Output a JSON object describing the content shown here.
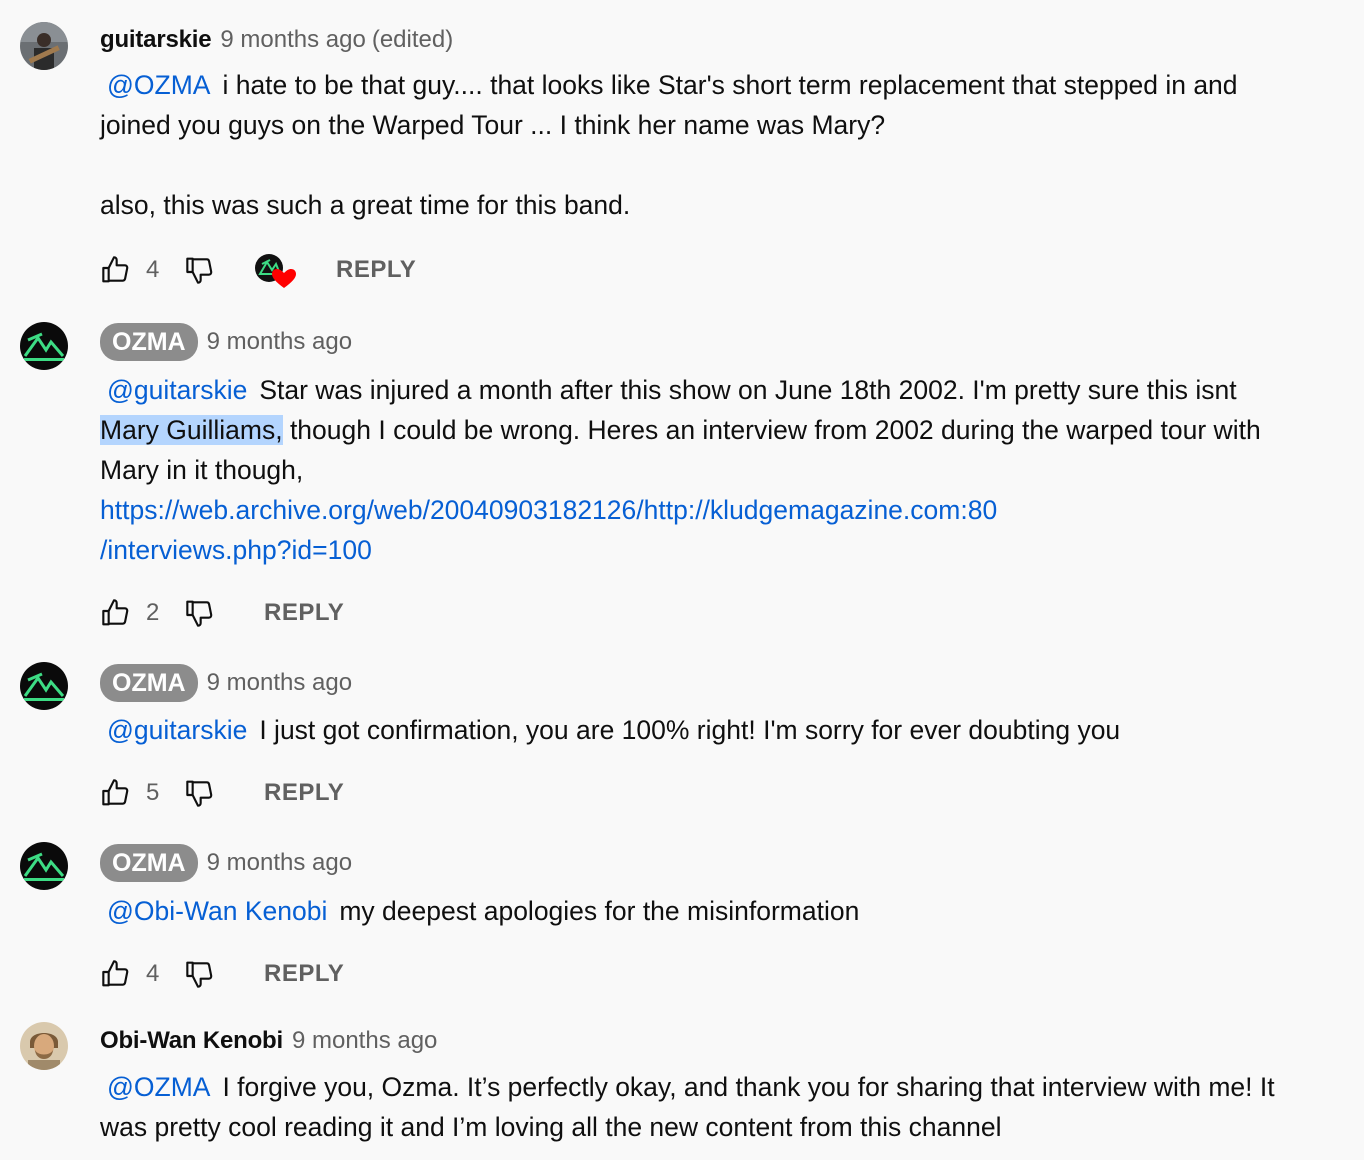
{
  "comments": [
    {
      "author": "guitarskie",
      "time": "9 months ago",
      "edited": "(edited)",
      "mention": "@OZMA",
      "text1": "i hate to be that guy.... that looks like Star's short term replacement that stepped in and joined you guys on the Warped Tour ... I think her name was Mary?",
      "text2": "also, this was such a great time for this band.",
      "likes": "4",
      "reply": "REPLY"
    },
    {
      "author": "OZMA",
      "time": "9 months ago",
      "mention": "@guitarskie",
      "text_a": "Star was injured a month after this show on June 18th 2002. I'm pretty sure this isnt ",
      "highlight": "Mary Guilliams,",
      "text_b": " though I could be wrong. Heres an interview from 2002 during the warped tour with Mary in it though,",
      "link1": "https://web.archive.org/web/20040903182126/http://kludgemagazine.com:80",
      "link2": "/interviews.php?id=100",
      "likes": "2",
      "reply": "REPLY"
    },
    {
      "author": "OZMA",
      "time": "9 months ago",
      "mention": "@guitarskie",
      "text": "I just got confirmation, you are 100% right! I'm sorry for ever doubting you",
      "likes": "5",
      "reply": "REPLY"
    },
    {
      "author": "OZMA",
      "time": "9 months ago",
      "mention": "@Obi-Wan Kenobi",
      "text": "my deepest apologies for the misinformation",
      "likes": "4",
      "reply": "REPLY"
    },
    {
      "author": "Obi-Wan Kenobi",
      "time": "9 months ago",
      "mention": "@OZMA",
      "text": "I forgive you, Ozma. It’s perfectly okay, and thank you for sharing that interview with me! It was pretty cool reading it and I’m loving all the new content from this channel"
    }
  ],
  "colors": {
    "link": "#065fd4",
    "secondary_text": "#606060",
    "owner_chip": "#8c8c8c",
    "heart": "#ff0000",
    "selection": "#b4d5fe"
  },
  "icons": [
    "like-icon",
    "dislike-icon",
    "creator-heart-icon"
  ]
}
